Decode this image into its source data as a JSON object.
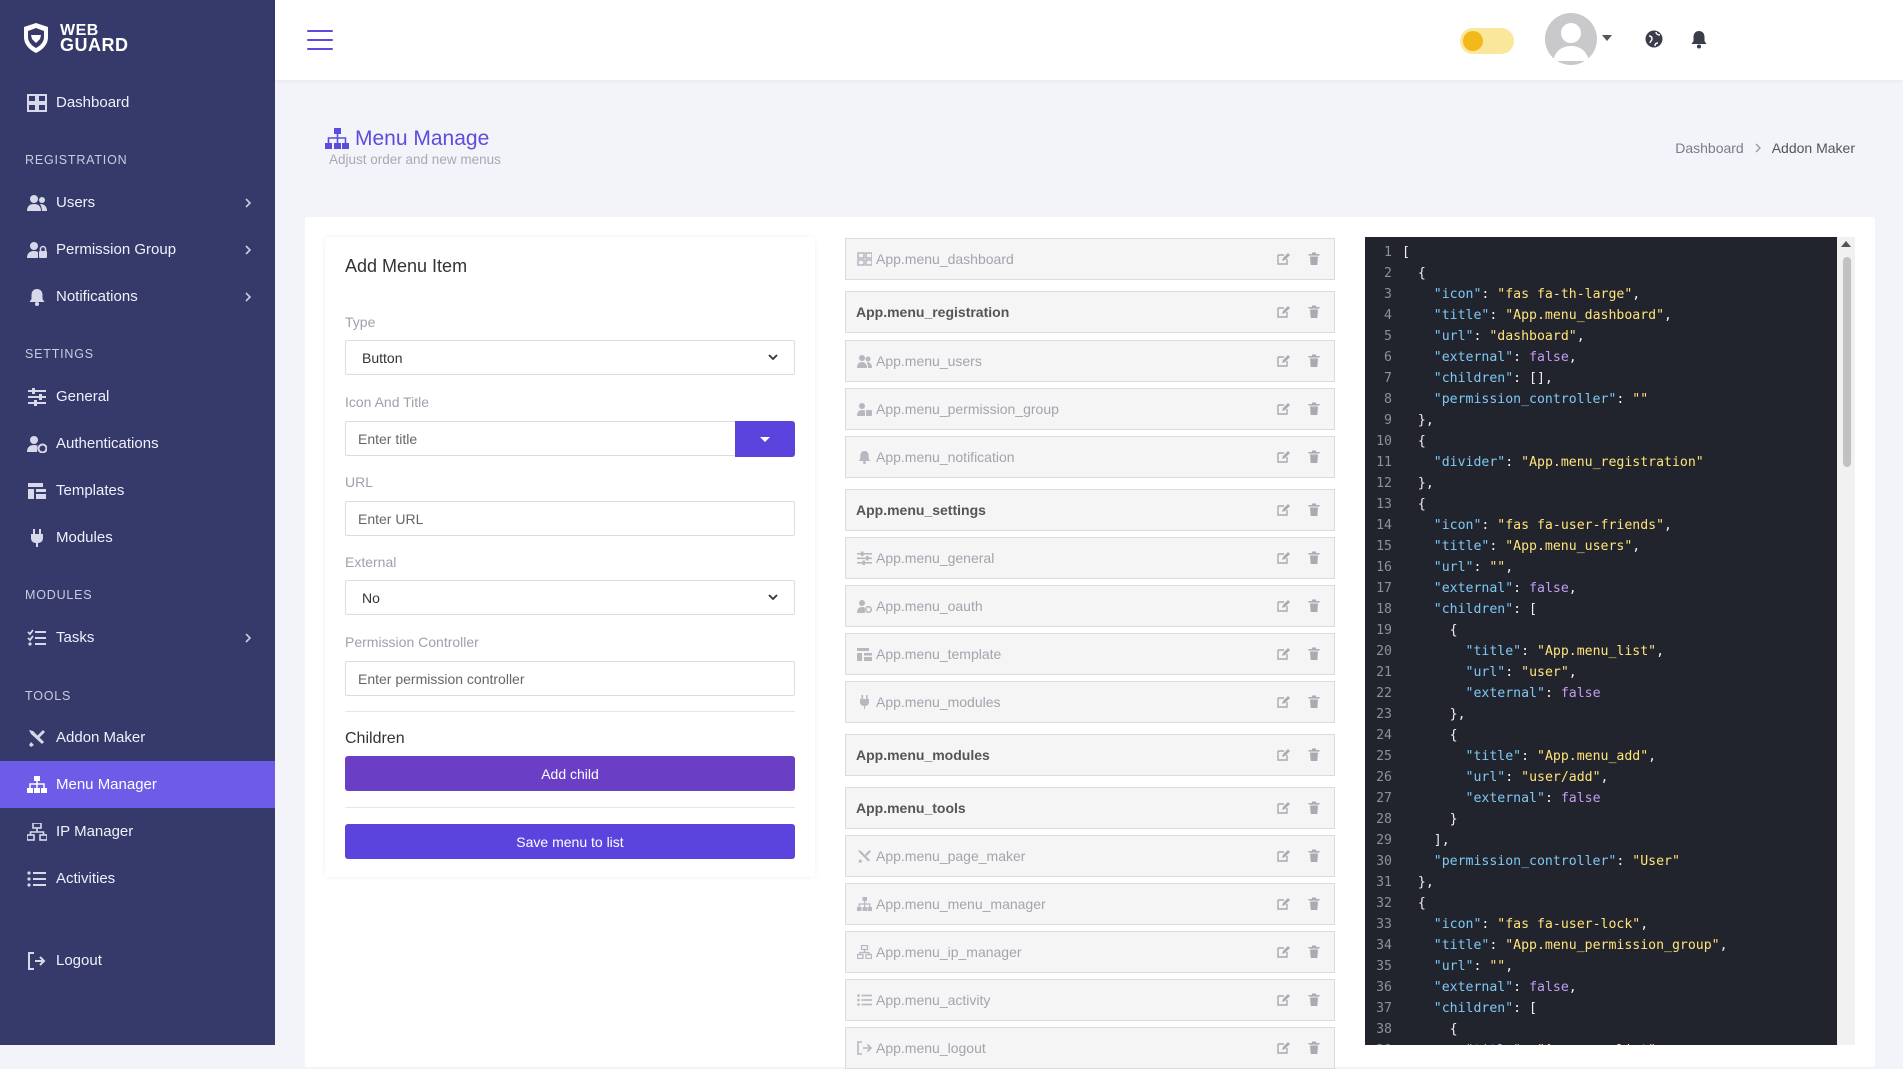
{
  "brand": {
    "line1": "WEB",
    "line2": "GUARD"
  },
  "sidebar": {
    "sections": {
      "registration": "REGISTRATION",
      "settings": "SETTINGS",
      "modules": "MODULES",
      "tools": "TOOLS"
    },
    "items": {
      "dashboard": "Dashboard",
      "users": "Users",
      "permission_group": "Permission Group",
      "notifications": "Notifications",
      "general": "General",
      "authentications": "Authentications",
      "templates": "Templates",
      "modules": "Modules",
      "tasks": "Tasks",
      "addon_maker": "Addon Maker",
      "menu_manager": "Menu Manager",
      "ip_manager": "IP Manager",
      "activities": "Activities",
      "logout": "Logout"
    },
    "active_item": "Menu Manager"
  },
  "header": {
    "theme_toggle_state": "light"
  },
  "page": {
    "title": "Menu Manage",
    "subtitle": "Adjust order and new menus",
    "breadcrumb": {
      "home": "Dashboard",
      "current": "Addon Maker"
    }
  },
  "form": {
    "title": "Add Menu Item",
    "type_label": "Type",
    "type_value": "Button",
    "icon_title_label": "Icon And Title",
    "title_placeholder": "Enter title",
    "url_label": "URL",
    "url_placeholder": "Enter URL",
    "external_label": "External",
    "external_value": "No",
    "permission_label": "Permission Controller",
    "permission_placeholder": "Enter permission controller",
    "children_title": "Children",
    "add_child": "Add child",
    "save": "Save menu to list"
  },
  "menu_list": [
    {
      "label": "App.menu_dashboard",
      "icon": "th-large-icon",
      "divider": false
    },
    {
      "label": "App.menu_registration",
      "icon": "",
      "divider": true
    },
    {
      "label": "App.menu_users",
      "icon": "user-friends-icon",
      "divider": false
    },
    {
      "label": "App.menu_permission_group",
      "icon": "user-lock-icon",
      "divider": false
    },
    {
      "label": "App.menu_notification",
      "icon": "bell-icon",
      "divider": false
    },
    {
      "label": "App.menu_settings",
      "icon": "",
      "divider": true
    },
    {
      "label": "App.menu_general",
      "icon": "sliders-icon",
      "divider": false
    },
    {
      "label": "App.menu_oauth",
      "icon": "user-cog-icon",
      "divider": false
    },
    {
      "label": "App.menu_template",
      "icon": "template-icon",
      "divider": false
    },
    {
      "label": "App.menu_modules",
      "icon": "plug-icon",
      "divider": false
    },
    {
      "label": "App.menu_modules",
      "icon": "",
      "divider": true
    },
    {
      "label": "App.menu_tools",
      "icon": "",
      "divider": true
    },
    {
      "label": "App.menu_page_maker",
      "icon": "tools-icon",
      "divider": false
    },
    {
      "label": "App.menu_menu_manager",
      "icon": "sitemap-icon",
      "divider": false
    },
    {
      "label": "App.menu_ip_manager",
      "icon": "network-icon",
      "divider": false
    },
    {
      "label": "App.menu_activity",
      "icon": "list-icon",
      "divider": false
    },
    {
      "label": "App.menu_logout",
      "icon": "logout-icon",
      "divider": false
    }
  ],
  "code_lines": [
    "[",
    "  {",
    "    \"icon\": \"fas fa-th-large\",",
    "    \"title\": \"App.menu_dashboard\",",
    "    \"url\": \"dashboard\",",
    "    \"external\": false,",
    "    \"children\": [],",
    "    \"permission_controller\": \"\"",
    "  },",
    "  {",
    "    \"divider\": \"App.menu_registration\"",
    "  },",
    "  {",
    "    \"icon\": \"fas fa-user-friends\",",
    "    \"title\": \"App.menu_users\",",
    "    \"url\": \"\",",
    "    \"external\": false,",
    "    \"children\": [",
    "      {",
    "        \"title\": \"App.menu_list\",",
    "        \"url\": \"user\",",
    "        \"external\": false",
    "      },",
    "      {",
    "        \"title\": \"App.menu_add\",",
    "        \"url\": \"user/add\",",
    "        \"external\": false",
    "      }",
    "    ],",
    "    \"permission_controller\": \"User\"",
    "  },",
    "  {",
    "    \"icon\": \"fas fa-user-lock\",",
    "    \"title\": \"App.menu_permission_group\",",
    "    \"url\": \"\",",
    "    \"external\": false,",
    "    \"children\": [",
    "      {",
    "        \"title\": \"App.menu_list\","
  ],
  "colors": {
    "sidebar": "#353a6a",
    "accent": "#5b44de",
    "active": "#6c5ce7",
    "add_child": "#6a3fc6",
    "editor_bg": "#22242d"
  }
}
